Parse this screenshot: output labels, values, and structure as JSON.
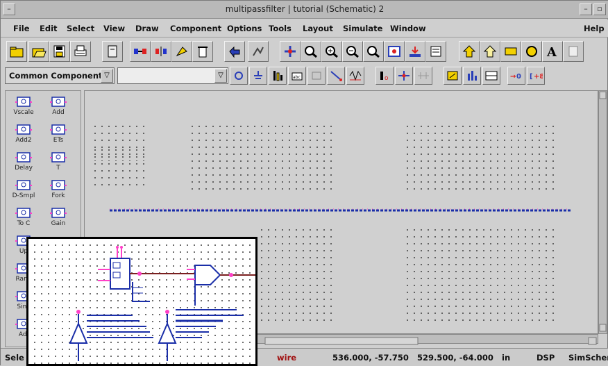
{
  "window": {
    "title": "multipassfilter | tutorial  (Schematic) 2",
    "minimize_glyph": "–",
    "restore_glyph": "▫",
    "sysmenu_glyph": "–"
  },
  "menu": [
    "File",
    "Edit",
    "Select",
    "View",
    "Draw",
    "Component",
    "Options",
    "Tools",
    "Layout",
    "Simulate",
    "Window",
    "Help"
  ],
  "library": {
    "selected": "Common Components",
    "search_value": "",
    "arrow_glyph": "▽"
  },
  "palette": [
    {
      "label": "Vscale",
      "icon": "vscale-icon"
    },
    {
      "label": "Add",
      "icon": "add-icon"
    },
    {
      "label": "Add2",
      "icon": "add2-icon"
    },
    {
      "label": "ETs",
      "icon": "ets-icon"
    },
    {
      "label": "Delay",
      "icon": "delay-icon"
    },
    {
      "label": "T",
      "icon": "t-icon"
    },
    {
      "label": "D-Smpl",
      "icon": "downsample-icon"
    },
    {
      "label": "Fork",
      "icon": "fork-icon"
    },
    {
      "label": "To C",
      "icon": "toc-icon"
    },
    {
      "label": "Gain",
      "icon": "gain-icon"
    },
    {
      "label": "Up",
      "icon": "upsample-icon"
    },
    {
      "label": "",
      "icon": ""
    },
    {
      "label": "Rand",
      "icon": "rand-icon"
    },
    {
      "label": "",
      "icon": ""
    },
    {
      "label": "Sink",
      "icon": "sink-icon"
    },
    {
      "label": "",
      "icon": ""
    },
    {
      "label": "Adj",
      "icon": "adj-icon"
    },
    {
      "label": "",
      "icon": ""
    }
  ],
  "status": {
    "select_hint": "Sele",
    "mode": "wire",
    "coord1": "536.000, -57.750",
    "coord2": "529.500, -64.000",
    "unit": "in",
    "domain": "DSP",
    "app": "SimSchem"
  },
  "colors": {
    "wire_blue": "#1a2ea8",
    "pin_pink": "#ff40c8",
    "wire_dark": "#7a1f1f"
  }
}
